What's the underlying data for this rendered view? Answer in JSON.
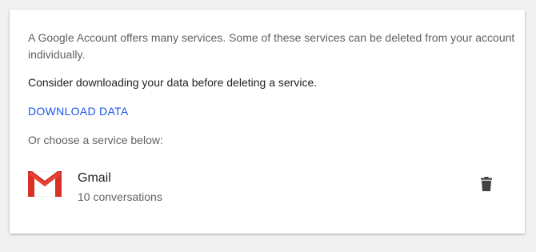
{
  "intro": {
    "text": "A Google Account offers many services. Some of these services can be deleted from your account individually."
  },
  "consider": {
    "text": "Consider downloading your data before deleting a service."
  },
  "download": {
    "label": "DOWNLOAD DATA"
  },
  "choose": {
    "text": "Or choose a service below:"
  },
  "service": {
    "name": "Gmail",
    "detail": "10 conversations",
    "icon": "gmail-icon",
    "action_icon": "trash-icon"
  },
  "colors": {
    "link": "#1a56e8",
    "gmail_red": "#db4437",
    "trash": "#424242"
  }
}
